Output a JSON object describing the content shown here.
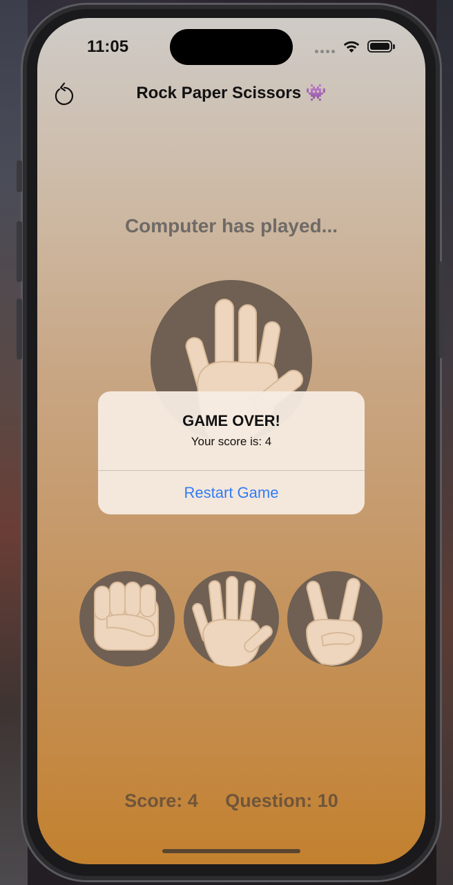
{
  "status_bar": {
    "time": "11:05"
  },
  "nav": {
    "title": "Rock Paper Scissors 👾",
    "restart_icon": "restart-icon"
  },
  "game": {
    "prompt": "Computer has played...",
    "computer_move": "paper"
  },
  "choices": [
    {
      "id": "rock",
      "icon": "fist-icon"
    },
    {
      "id": "paper",
      "icon": "open-hand-icon"
    },
    {
      "id": "scissors",
      "icon": "victory-hand-icon"
    }
  ],
  "alert": {
    "title": "GAME OVER!",
    "message": "Your score is: 4",
    "button": "Restart Game"
  },
  "footer": {
    "score": "Score: 4",
    "question": "Question: 10"
  },
  "colors": {
    "accent_link": "#2f7cf6",
    "hand_circle": "#6f6053",
    "gradient_top": "#cfcbc7",
    "gradient_bottom": "#c3812f"
  }
}
